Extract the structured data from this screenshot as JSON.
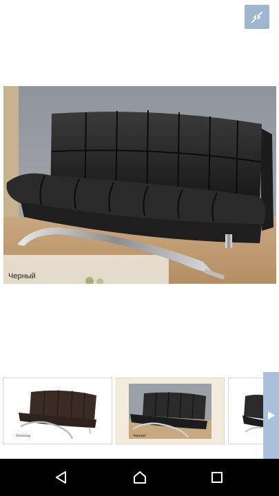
{
  "viewer": {
    "collapse_icon": "collapse-arrows-icon",
    "main_image": {
      "caption": "Черный"
    }
  },
  "thumbnails": [
    {
      "caption": "Шоколад",
      "selected": false
    },
    {
      "caption": "Черный",
      "selected": true
    },
    {
      "caption": "",
      "selected": false
    }
  ],
  "carousel": {
    "next_icon": "chevron-right-icon"
  },
  "navbar": {
    "back_icon": "back-triangle-icon",
    "home_icon": "home-circle-icon",
    "recents_icon": "recents-square-icon"
  },
  "colors": {
    "accent_button": "#9fb6d0",
    "navbar_bg": "#000000"
  }
}
